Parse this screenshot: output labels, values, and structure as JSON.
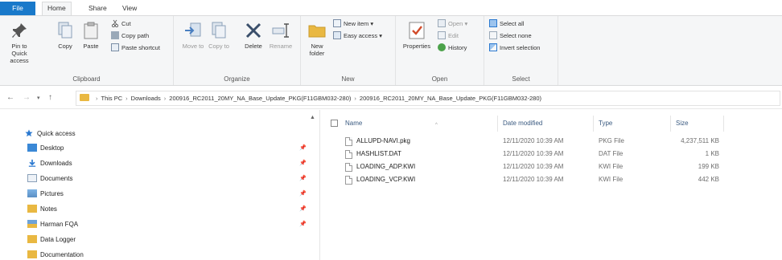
{
  "tabs": {
    "file": "File",
    "home": "Home",
    "share": "Share",
    "view": "View"
  },
  "ribbon": {
    "clipboard": {
      "label": "Clipboard",
      "pin": "Pin to Quick access",
      "copy": "Copy",
      "paste": "Paste",
      "cut": "Cut",
      "copy_path": "Copy path",
      "paste_shortcut": "Paste shortcut"
    },
    "organize": {
      "label": "Organize",
      "move_to": "Move to",
      "copy_to": "Copy to",
      "delete": "Delete",
      "rename": "Rename"
    },
    "new": {
      "label": "New",
      "new_folder": "New folder",
      "new_item": "New item",
      "easy_access": "Easy access"
    },
    "open": {
      "label": "Open",
      "properties": "Properties",
      "open": "Open",
      "edit": "Edit",
      "history": "History"
    },
    "select": {
      "label": "Select",
      "select_all": "Select all",
      "select_none": "Select none",
      "invert_selection": "Invert selection"
    }
  },
  "address": {
    "crumbs": [
      "This PC",
      "Downloads",
      "200916_RC2011_20MY_NA_Base_Update_PKG(F11GBM032-280)",
      "200916_RC2011_20MY_NA_Base_Update_PKG(F11GBM032-280)"
    ]
  },
  "sidebar": {
    "items": [
      {
        "label": "Quick access",
        "icon": "star-icon"
      },
      {
        "label": "Desktop",
        "icon": "desktop-icon"
      },
      {
        "label": "Downloads",
        "icon": "download-icon"
      },
      {
        "label": "Documents",
        "icon": "documents-icon"
      },
      {
        "label": "Pictures",
        "icon": "pictures-icon"
      },
      {
        "label": "Notes",
        "icon": "folder-icon"
      },
      {
        "label": "Harman FQA",
        "icon": "network-folder-icon"
      },
      {
        "label": "Data Logger",
        "icon": "folder-icon"
      },
      {
        "label": "Documentation",
        "icon": "folder-icon"
      }
    ]
  },
  "filelist": {
    "columns": {
      "name": "Name",
      "date": "Date modified",
      "type": "Type",
      "size": "Size"
    },
    "rows": [
      {
        "name": "ALLUPD-NAVI.pkg",
        "date": "12/11/2020 10:39 AM",
        "type": "PKG File",
        "size": "4,237,511 KB"
      },
      {
        "name": "HASHLIST.DAT",
        "date": "12/11/2020 10:39 AM",
        "type": "DAT File",
        "size": "1 KB"
      },
      {
        "name": "LOADING_ADP.KWI",
        "date": "12/11/2020 10:39 AM",
        "type": "KWI File",
        "size": "199 KB"
      },
      {
        "name": "LOADING_VCP.KWI",
        "date": "12/11/2020 10:39 AM",
        "type": "KWI File",
        "size": "442 KB"
      }
    ]
  },
  "colors": {
    "file_tab": "#1979ca",
    "folder": "#e9b842",
    "accent_blue": "#2b79d0"
  }
}
